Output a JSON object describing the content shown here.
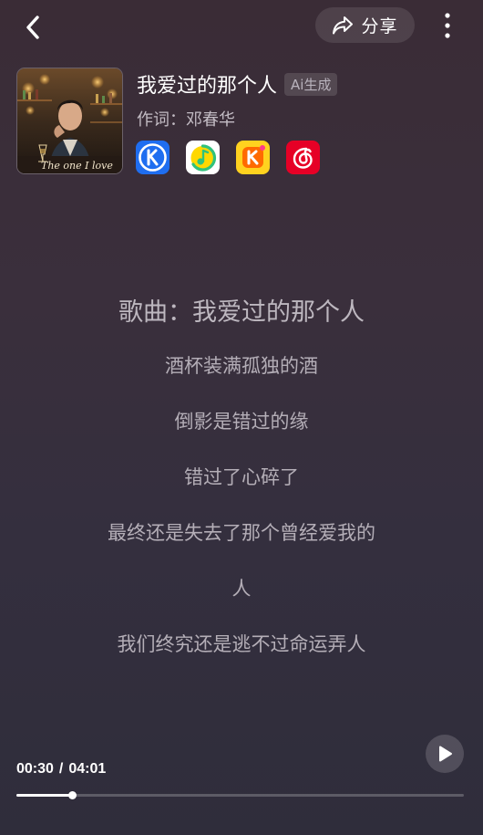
{
  "header": {
    "share_label": "分享",
    "icons": [
      "chevron-left-icon",
      "share-arrow-icon",
      "more-vertical-icon"
    ]
  },
  "song": {
    "title": "我爱过的那个人",
    "ai_badge": "Ai生成",
    "lyricist": "作词：邓春华",
    "cover_script_text": "The one I love"
  },
  "platforms": [
    {
      "name": "kugou",
      "bg": "#1f6ef0",
      "fg": "#ffffff"
    },
    {
      "name": "qq-music",
      "bg": "#ffffff",
      "fg": "#31c27c",
      "accent": "#ffd800"
    },
    {
      "name": "kuwo-k",
      "bg": "#ffd21f",
      "fg": "#ff6a00"
    },
    {
      "name": "netease-music",
      "bg": "#e60026",
      "fg": "#ffffff"
    }
  ],
  "lyrics": {
    "heading": "歌曲：我爱过的那个人",
    "lines": [
      "酒杯装满孤独的酒",
      "倒影是错过的缘",
      "错过了心碎了",
      "最终还是失去了那个曾经爱我的",
      "人",
      "我们终究还是逃不过命运弄人"
    ]
  },
  "player": {
    "current_time": "00:30",
    "separator": "/",
    "total_time": "04:01",
    "progress": 0.1245
  }
}
